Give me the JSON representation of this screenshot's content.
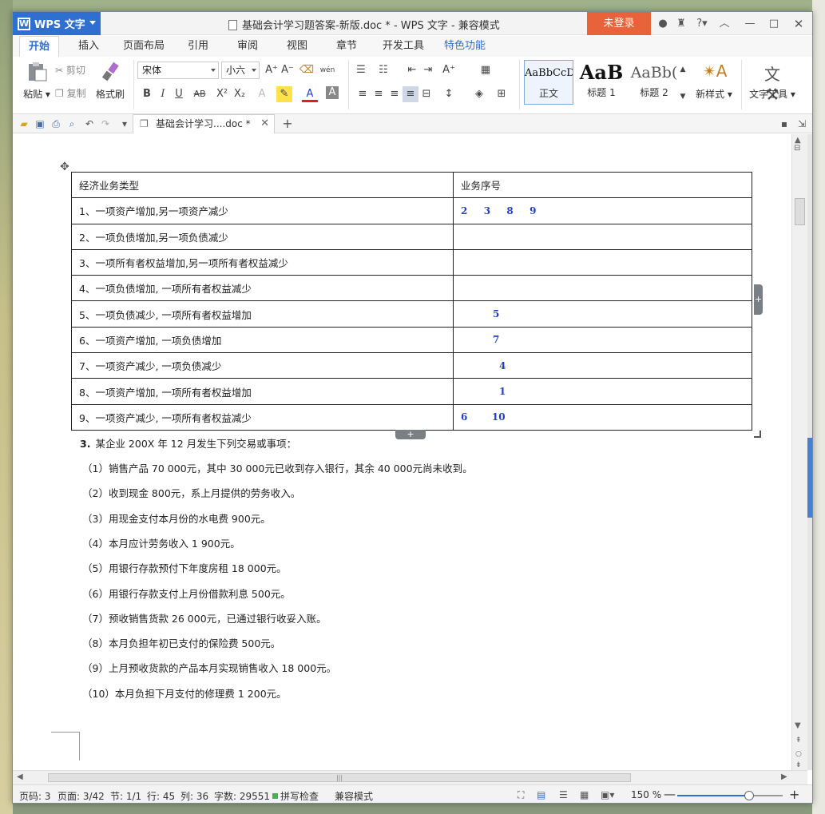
{
  "titlebar": {
    "app_name": "WPS 文字",
    "doc_title": "基础会计学习题答案-新版.doc * - WPS 文字 - 兼容模式",
    "login": "未登录"
  },
  "menu": {
    "tabs": [
      "开始",
      "插入",
      "页面布局",
      "引用",
      "审阅",
      "视图",
      "章节",
      "开发工具",
      "特色功能"
    ],
    "active": "开始"
  },
  "ribbon": {
    "paste": "粘贴",
    "cut": "剪切",
    "copy": "复制",
    "format_painter": "格式刷",
    "font_name": "宋体",
    "font_size": "小六",
    "styles": [
      {
        "sample": "AaBbCcD",
        "label": "正文"
      },
      {
        "sample": "AaB",
        "label": "标题 1"
      },
      {
        "sample": "AaBb(",
        "label": "标题 2"
      }
    ],
    "new_style": "新样式",
    "text_tools": "文字工具"
  },
  "tabbar": {
    "doc_tab": "基础会计学习....doc *"
  },
  "table": {
    "header": [
      "经济业务类型",
      "业务序号"
    ],
    "rows": [
      {
        "type": "1、一项资产增加,另一项资产减少",
        "seq": "2  3  8  9",
        "indent": 0
      },
      {
        "type": "2、一项负债增加,另一项负债减少",
        "seq": "",
        "indent": 0
      },
      {
        "type": "3、一项所有者权益增加,另一项所有者权益减少",
        "seq": "",
        "indent": 0
      },
      {
        "type": "4、一项负债增加, 一项所有者权益减少",
        "seq": "",
        "indent": 0
      },
      {
        "type": "5、一项负债减少, 一项所有者权益增加",
        "seq": "5",
        "indent": 40
      },
      {
        "type": "6、一项资产增加, 一项负债增加",
        "seq": "7",
        "indent": 40
      },
      {
        "type": "7、一项资产减少, 一项负债减少",
        "seq": "4",
        "indent": 48
      },
      {
        "type": "8、一项资产增加, 一项所有者权益增加",
        "seq": "1",
        "indent": 48
      },
      {
        "type": "9、一项资产减少, 一项所有者权益减少",
        "seq": "6   10",
        "indent": 0
      }
    ]
  },
  "question": {
    "number": "3.",
    "title": "某企业 200X 年 12 月发生下列交易或事项：",
    "items": [
      "（1）销售产品 70 000元，其中 30 000元已收到存入银行，其余 40 000元尚未收到。",
      "（2）收到现金 800元，系上月提供的劳务收入。",
      "（3）用现金支付本月份的水电费 900元。",
      "（4）本月应计劳务收入 1 900元。",
      "（5）用银行存款预付下年度房租 18 000元。",
      "（6）用银行存款支付上月份借款利息 500元。",
      "（7）预收销售货款 26 000元，已通过银行收妥入账。",
      "（8）本月负担年初已支付的保险费 500元。",
      "（9）上月预收货款的产品本月实现销售收入 18 000元。",
      "（10）本月负担下月支付的修理费 1 200元。"
    ]
  },
  "status": {
    "page_code": "页码: 3",
    "page": "页面: 3/42",
    "section": "节: 1/1",
    "row": "行: 45",
    "col": "列: 36",
    "words": "字数: 29551",
    "spell": "拼写检查",
    "compat": "兼容模式",
    "zoom": "150 %",
    "zoom_level": 0.68
  },
  "colors": {
    "accent": "#2f6fd0",
    "login": "#e8623a",
    "answer": "#1f3fc4"
  }
}
